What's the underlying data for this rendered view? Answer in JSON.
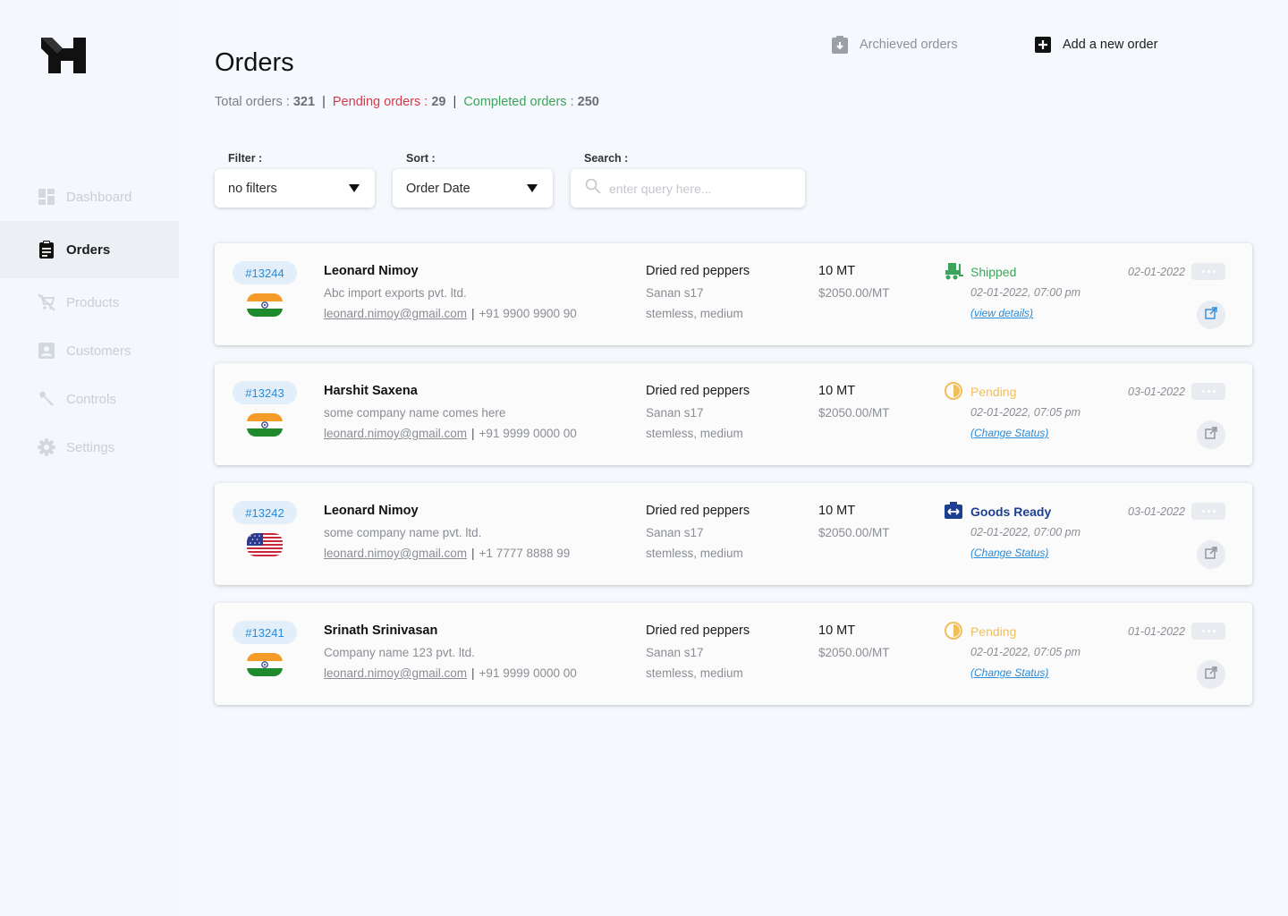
{
  "sidebar": {
    "items": [
      {
        "label": "Dashboard",
        "icon": "dashboard-icon",
        "active": false
      },
      {
        "label": "Orders",
        "icon": "clipboard-icon",
        "active": true
      },
      {
        "label": "Products",
        "icon": "cart-off-icon",
        "active": false
      },
      {
        "label": "Customers",
        "icon": "person-icon",
        "active": false
      },
      {
        "label": "Controls",
        "icon": "wrench-icon",
        "active": false
      },
      {
        "label": "Settings",
        "icon": "gear-icon",
        "active": false
      }
    ]
  },
  "header": {
    "title": "Orders",
    "archived_label": "Archieved orders",
    "add_label": "Add a new order"
  },
  "stats": {
    "total_label": "Total orders : ",
    "total_value": "321",
    "pending_label": "Pending orders : ",
    "pending_value": "29",
    "completed_label": "Completed orders : ",
    "completed_value": "250",
    "separator": "|"
  },
  "controls": {
    "filter_label": "Filter :",
    "filter_value": "no filters",
    "sort_label": "Sort :",
    "sort_value": "Order Date",
    "search_label": "Search :",
    "search_placeholder": "enter query here..."
  },
  "colors": {
    "accent": "#2a8bd6",
    "pending": "#f0bf5a",
    "shipped": "#3aa55a",
    "goods_ready": "#1d3f8f",
    "stats_red": "#d9394a",
    "stats_green": "#3aa55a"
  },
  "orders": [
    {
      "id": "#13244",
      "flag": "india",
      "customer_name": "Leonard Nimoy",
      "company": "Abc import exports pvt. ltd.",
      "email": "leonard.nimoy@gmail.com",
      "phone": "+91 9900 9900 90",
      "product": "Dried red peppers",
      "variety": "Sanan s17",
      "description": "stemless, medium",
      "quantity": "10 MT",
      "price": "$2050.00/MT",
      "status": "Shipped",
      "status_icon": "forklift-icon",
      "status_date": "02-01-2022, 07:00 pm",
      "status_link": "(view details)",
      "order_date": "02-01-2022"
    },
    {
      "id": "#13243",
      "flag": "india",
      "customer_name": "Harshit Saxena",
      "company": "some company name comes here",
      "email": "leonard.nimoy@gmail.com",
      "phone": "+91 9999 0000 00",
      "product": "Dried red peppers",
      "variety": "Sanan s17",
      "description": "stemless, medium",
      "quantity": "10 MT",
      "price": "$2050.00/MT",
      "status": "Pending",
      "status_icon": "clock-icon",
      "status_date": "02-01-2022, 07:05 pm",
      "status_link": "(Change Status)",
      "order_date": "03-01-2022"
    },
    {
      "id": "#13242",
      "flag": "usa",
      "customer_name": "Leonard Nimoy",
      "company": "some company name pvt. ltd.",
      "email": "leonard.nimoy@gmail.com",
      "phone": "+1 7777 8888 99",
      "product": "Dried red peppers",
      "variety": "Sanan s17",
      "description": "stemless, medium",
      "quantity": "10 MT",
      "price": "$2050.00/MT",
      "status": "Goods Ready",
      "status_icon": "package-icon",
      "status_date": "02-01-2022, 07:00 pm",
      "status_link": "(Change Status)",
      "order_date": "03-01-2022"
    },
    {
      "id": "#13241",
      "flag": "india",
      "customer_name": "Srinath Srinivasan",
      "company": "Company name 123 pvt. ltd.",
      "email": "leonard.nimoy@gmail.com",
      "phone": "+91 9999 0000 00",
      "product": "Dried red peppers",
      "variety": "Sanan s17",
      "description": "stemless, medium",
      "quantity": "10 MT",
      "price": "$2050.00/MT",
      "status": "Pending",
      "status_icon": "clock-icon",
      "status_date": "02-01-2022, 07:05 pm",
      "status_link": "(Change Status)",
      "order_date": "01-01-2022"
    }
  ]
}
